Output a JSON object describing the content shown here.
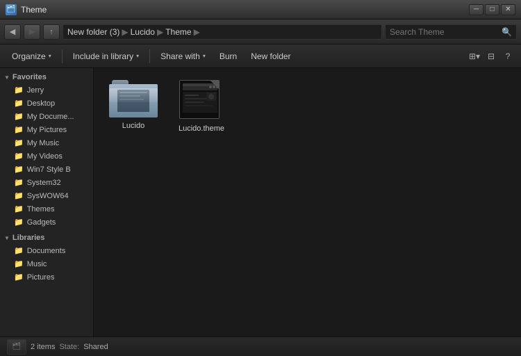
{
  "window": {
    "title": "Theme",
    "icon": "🗂"
  },
  "window_controls": {
    "minimize": "─",
    "maximize": "□",
    "close": "✕"
  },
  "nav": {
    "back": "◀",
    "forward": "▶",
    "up": "↑",
    "address_parts": [
      "New folder (3)",
      "Lucido",
      "Theme"
    ],
    "address_separator": "▶",
    "search_placeholder": "Search Theme"
  },
  "toolbar": {
    "organize_label": "Organize",
    "include_label": "Include in library",
    "share_label": "Share with",
    "burn_label": "Burn",
    "new_folder_label": "New folder",
    "view_icon": "⚙",
    "help_icon": "?"
  },
  "sidebar": {
    "favorites_label": "Favorites",
    "favorites_items": [
      {
        "label": "Jerry",
        "name": "sidebar-item-jerry"
      },
      {
        "label": "Desktop",
        "name": "sidebar-item-desktop"
      },
      {
        "label": "My Documents",
        "name": "sidebar-item-mydocuments"
      },
      {
        "label": "My Pictures",
        "name": "sidebar-item-mypictures"
      },
      {
        "label": "My Music",
        "name": "sidebar-item-mymusic"
      },
      {
        "label": "My Videos",
        "name": "sidebar-item-myvideos"
      },
      {
        "label": "Win7 Style B",
        "name": "sidebar-item-win7style"
      },
      {
        "label": "System32",
        "name": "sidebar-item-system32"
      },
      {
        "label": "SysWOW64",
        "name": "sidebar-item-syswow64"
      },
      {
        "label": "Themes",
        "name": "sidebar-item-themes"
      },
      {
        "label": "Gadgets",
        "name": "sidebar-item-gadgets"
      }
    ],
    "libraries_label": "Libraries",
    "libraries_items": [
      {
        "label": "Documents",
        "name": "sidebar-item-documents"
      },
      {
        "label": "Music",
        "name": "sidebar-item-music"
      },
      {
        "label": "Pictures",
        "name": "sidebar-item-pictures"
      }
    ]
  },
  "files": [
    {
      "name": "Lucido",
      "type": "folder",
      "label": "Lucido"
    },
    {
      "name": "Lucido.theme",
      "type": "theme",
      "label": "Lucido.theme"
    }
  ],
  "status": {
    "count": "2 items",
    "state_label": "State:",
    "state_value": "Shared",
    "icon": "🗂"
  }
}
